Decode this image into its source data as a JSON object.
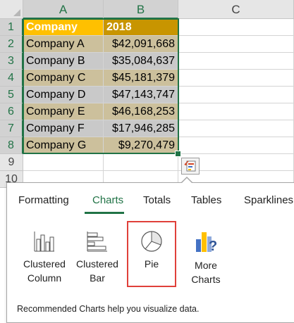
{
  "columns": [
    "A",
    "B",
    "C"
  ],
  "rows": [
    "1",
    "2",
    "3",
    "4",
    "5",
    "6",
    "7",
    "8",
    "9",
    "10"
  ],
  "table": {
    "headers": [
      "Company",
      "2018"
    ],
    "data": [
      [
        "Company A",
        "$42,091,668"
      ],
      [
        "Company B",
        "$35,084,637"
      ],
      [
        "Company C",
        "$45,181,379"
      ],
      [
        "Company D",
        "$47,143,747"
      ],
      [
        "Company E",
        "$46,168,253"
      ],
      [
        "Company F",
        "$17,946,285"
      ],
      [
        "Company G",
        "$9,270,479"
      ]
    ]
  },
  "quick_analysis": {
    "tabs": [
      "Formatting",
      "Charts",
      "Totals",
      "Tables",
      "Sparklines"
    ],
    "active_tab": "Charts",
    "options": [
      {
        "label_line1": "Clustered",
        "label_line2": "Column",
        "icon": "clustered-column-chart-icon"
      },
      {
        "label_line1": "Clustered",
        "label_line2": "Bar",
        "icon": "clustered-bar-chart-icon"
      },
      {
        "label_line1": "Pie",
        "label_line2": "",
        "icon": "pie-chart-icon"
      },
      {
        "label_line1": "More",
        "label_line2": "Charts",
        "icon": "more-charts-icon"
      }
    ],
    "highlighted_option": "Pie",
    "hint": "Recommended Charts help you visualize data."
  },
  "colors": {
    "accent": "#217346",
    "header_a": "#ffc000",
    "header_b": "#c89500",
    "band_tan": "#ccc09c",
    "band_gray": "#c9c9c9",
    "highlight_border": "#e0403a"
  }
}
